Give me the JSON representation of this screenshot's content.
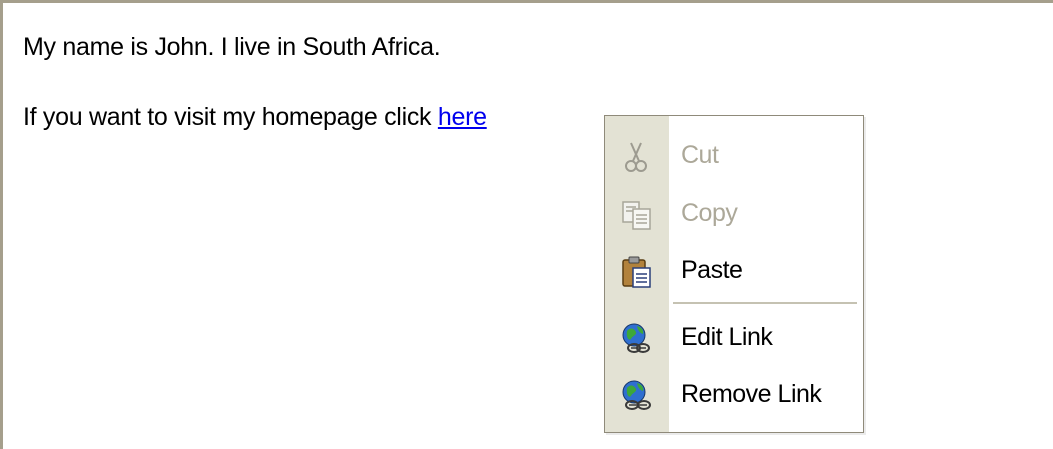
{
  "document": {
    "line1": "My name is John. I live in South Africa.",
    "line2_prefix": "If you want to visit my homepage click ",
    "link_text": "here"
  },
  "context_menu": {
    "items": [
      {
        "label": "Cut",
        "icon": "scissors-icon",
        "enabled": false
      },
      {
        "label": "Copy",
        "icon": "copy-icon",
        "enabled": false
      },
      {
        "label": "Paste",
        "icon": "paste-icon",
        "enabled": true
      },
      {
        "label": "Edit Link",
        "icon": "edit-link-icon",
        "enabled": true
      },
      {
        "label": "Remove Link",
        "icon": "remove-link-icon",
        "enabled": true
      }
    ]
  },
  "colors": {
    "link": "#0000ee",
    "menu_gutter": "#e3e2d4",
    "disabled_text": "#aca899",
    "border": "#a59f8c"
  }
}
